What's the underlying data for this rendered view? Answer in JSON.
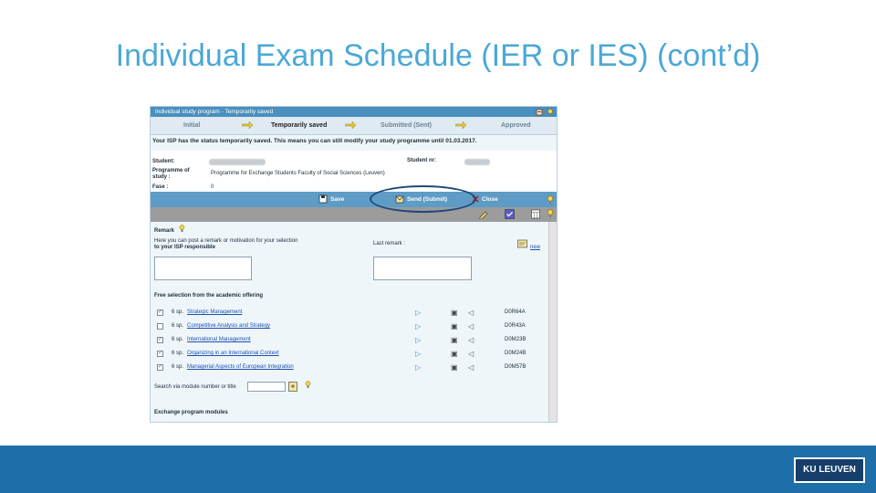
{
  "slide": {
    "title": "Individual Exam Schedule (IER or IES) (cont’d)",
    "logo": "KU LEUVEN"
  },
  "screenshot": {
    "window_title": "Individual study program  -  Temporarily saved",
    "status_steps": [
      "Initial",
      "Temporarily saved",
      "Submitted (Sent)",
      "Approved"
    ],
    "active_step": "Temporarily saved",
    "notice": "Your ISP has the status temporarily saved. This means you can still modify your study programme until 01.03.2017.",
    "student": {
      "student_label": "Student:",
      "student_no_label": "Student nr:",
      "programme_label": "Programme of study :",
      "programme_value": "Programme for Exchange Students Faculty of Social Sciences (Leuven)",
      "fase_label": "Fase :",
      "fase_value": "0"
    },
    "actions": {
      "save": "Save",
      "send": "Send (Submit)",
      "close": "Close"
    },
    "remark": {
      "heading": "Remark",
      "prompt_line1": "Here you can post a remark or motivation for your selection",
      "prompt_line2": "to your ISP responsible",
      "last_remark_label": "Last remark :",
      "new_link": "new"
    },
    "free_selection": {
      "heading": "Free selection from the academic offering",
      "courses": [
        {
          "credits": "6 sp.",
          "title": "Strategic Management",
          "code": "D0R64A",
          "checked": true
        },
        {
          "credits": "6 sp.",
          "title": "Competitive Analysis and Strategy",
          "code": "D0R43A",
          "checked": false
        },
        {
          "credits": "6 sp.",
          "title": "International Management",
          "code": "D0M23B",
          "checked": true
        },
        {
          "credits": "6 sp.",
          "title": "Organizing in an International Context",
          "code": "D0M24B",
          "checked": true
        },
        {
          "credits": "6 sp.",
          "title": "Managerial Aspects of European Integration",
          "code": "D0M57B",
          "checked": true
        }
      ],
      "search_label": "Search via module number or title"
    },
    "exchange_heading": "Exchange program modules",
    "colors": {
      "header": "#4a8fbe",
      "action_bar": "#5e9cc6",
      "highlight": "#1f4978"
    }
  }
}
